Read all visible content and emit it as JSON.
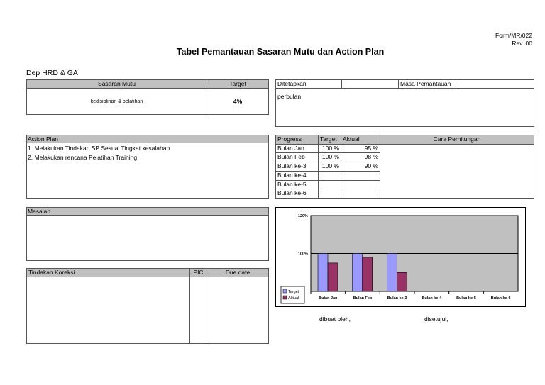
{
  "form_code": "Form/MR/022",
  "revision": "Rev. 00",
  "title": "Tabel Pemantauan Sasaran Mutu dan Action Plan",
  "department": "Dep HRD & GA",
  "sasaran": {
    "header_sasaran": "Sasaran Mutu",
    "header_target": "Target",
    "value_sasaran": "kedisiplinan & pelatihan",
    "value_target": "4%"
  },
  "ditetapkan": {
    "label": "Ditetapkan",
    "value": "",
    "masa_label": "Masa Pemantauan",
    "masa_value": "",
    "body": "perbulan"
  },
  "action_plan": {
    "header": "Action Plan",
    "items": [
      "1. Melakukan Tindakan SP Sesuai Tingkat kesalahan",
      "2. Melakukan rencana Pelatihan  Training"
    ]
  },
  "progress": {
    "headers": [
      "Progress",
      "Target",
      "Aktual",
      "Cara Perhitungan"
    ],
    "rows": [
      {
        "label": "Bulan Jan",
        "target": "100 %",
        "aktual": "95 %"
      },
      {
        "label": "Bulan Feb",
        "target": "100 %",
        "aktual": "98 %"
      },
      {
        "label": "Bulan ke-3",
        "target": "100 %",
        "aktual": "90 %"
      },
      {
        "label": "Bulan ke-4",
        "target": "",
        "aktual": ""
      },
      {
        "label": "Bulan ke-5",
        "target": "",
        "aktual": ""
      },
      {
        "label": "Bulan ke-6",
        "target": "",
        "aktual": ""
      }
    ]
  },
  "masalah": {
    "header": "Masalah"
  },
  "tindakan": {
    "header": "Tindakan Koreksi",
    "pic": "PIC",
    "due": "Due date"
  },
  "signatures": {
    "dibuat": "dibuat oleh,",
    "disetujui": "disetujui,"
  },
  "chart_data": {
    "type": "bar",
    "categories": [
      "Bulan Jan",
      "Bulan Feb",
      "Bulan ke-3",
      "Bulan ke-4",
      "Bulan ke-5",
      "Bulan ke-6"
    ],
    "series": [
      {
        "name": "Target",
        "values": [
          100,
          100,
          100,
          null,
          null,
          null
        ],
        "color": "#9999ff"
      },
      {
        "name": "Aktual",
        "values": [
          95,
          98,
          90,
          null,
          null,
          null
        ],
        "color": "#993366"
      }
    ],
    "yticks": [
      "120%",
      "100%"
    ],
    "ylim": [
      80,
      120
    ],
    "legend": "bottom-left",
    "plot_bg": "#c0c0c0"
  }
}
